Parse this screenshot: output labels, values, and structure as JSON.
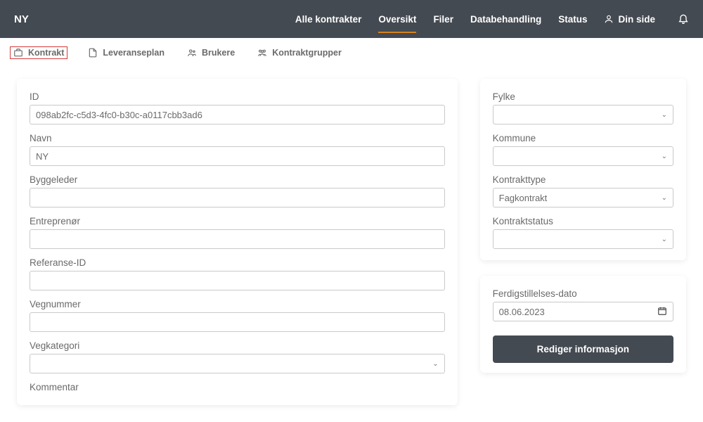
{
  "header": {
    "title": "NY",
    "nav": {
      "alle_kontrakter": "Alle kontrakter",
      "oversikt": "Oversikt",
      "filer": "Filer",
      "databehandling": "Databehandling",
      "status": "Status",
      "din_side": "Din side"
    }
  },
  "subtabs": {
    "kontrakt": "Kontrakt",
    "leveranseplan": "Leveranseplan",
    "brukere": "Brukere",
    "kontraktgrupper": "Kontraktgrupper"
  },
  "form": {
    "id_label": "ID",
    "id_value": "098ab2fc-c5d3-4fc0-b30c-a0117cbb3ad6",
    "navn_label": "Navn",
    "navn_value": "NY",
    "byggeleder_label": "Byggeleder",
    "byggeleder_value": "",
    "entreprenor_label": "Entreprenør",
    "entreprenor_value": "",
    "referanse_label": "Referanse-ID",
    "referanse_value": "",
    "vegnummer_label": "Vegnummer",
    "vegnummer_value": "",
    "vegkategori_label": "Vegkategori",
    "vegkategori_value": "",
    "kommentar_label": "Kommentar"
  },
  "side": {
    "fylke_label": "Fylke",
    "fylke_value": "",
    "kommune_label": "Kommune",
    "kommune_value": "",
    "kontrakttype_label": "Kontrakttype",
    "kontrakttype_value": "Fagkontrakt",
    "kontraktstatus_label": "Kontraktstatus",
    "kontraktstatus_value": "",
    "ferdig_label": "Ferdigstillelses-dato",
    "ferdig_value": "08.06.2023",
    "action": "Rediger informasjon"
  }
}
